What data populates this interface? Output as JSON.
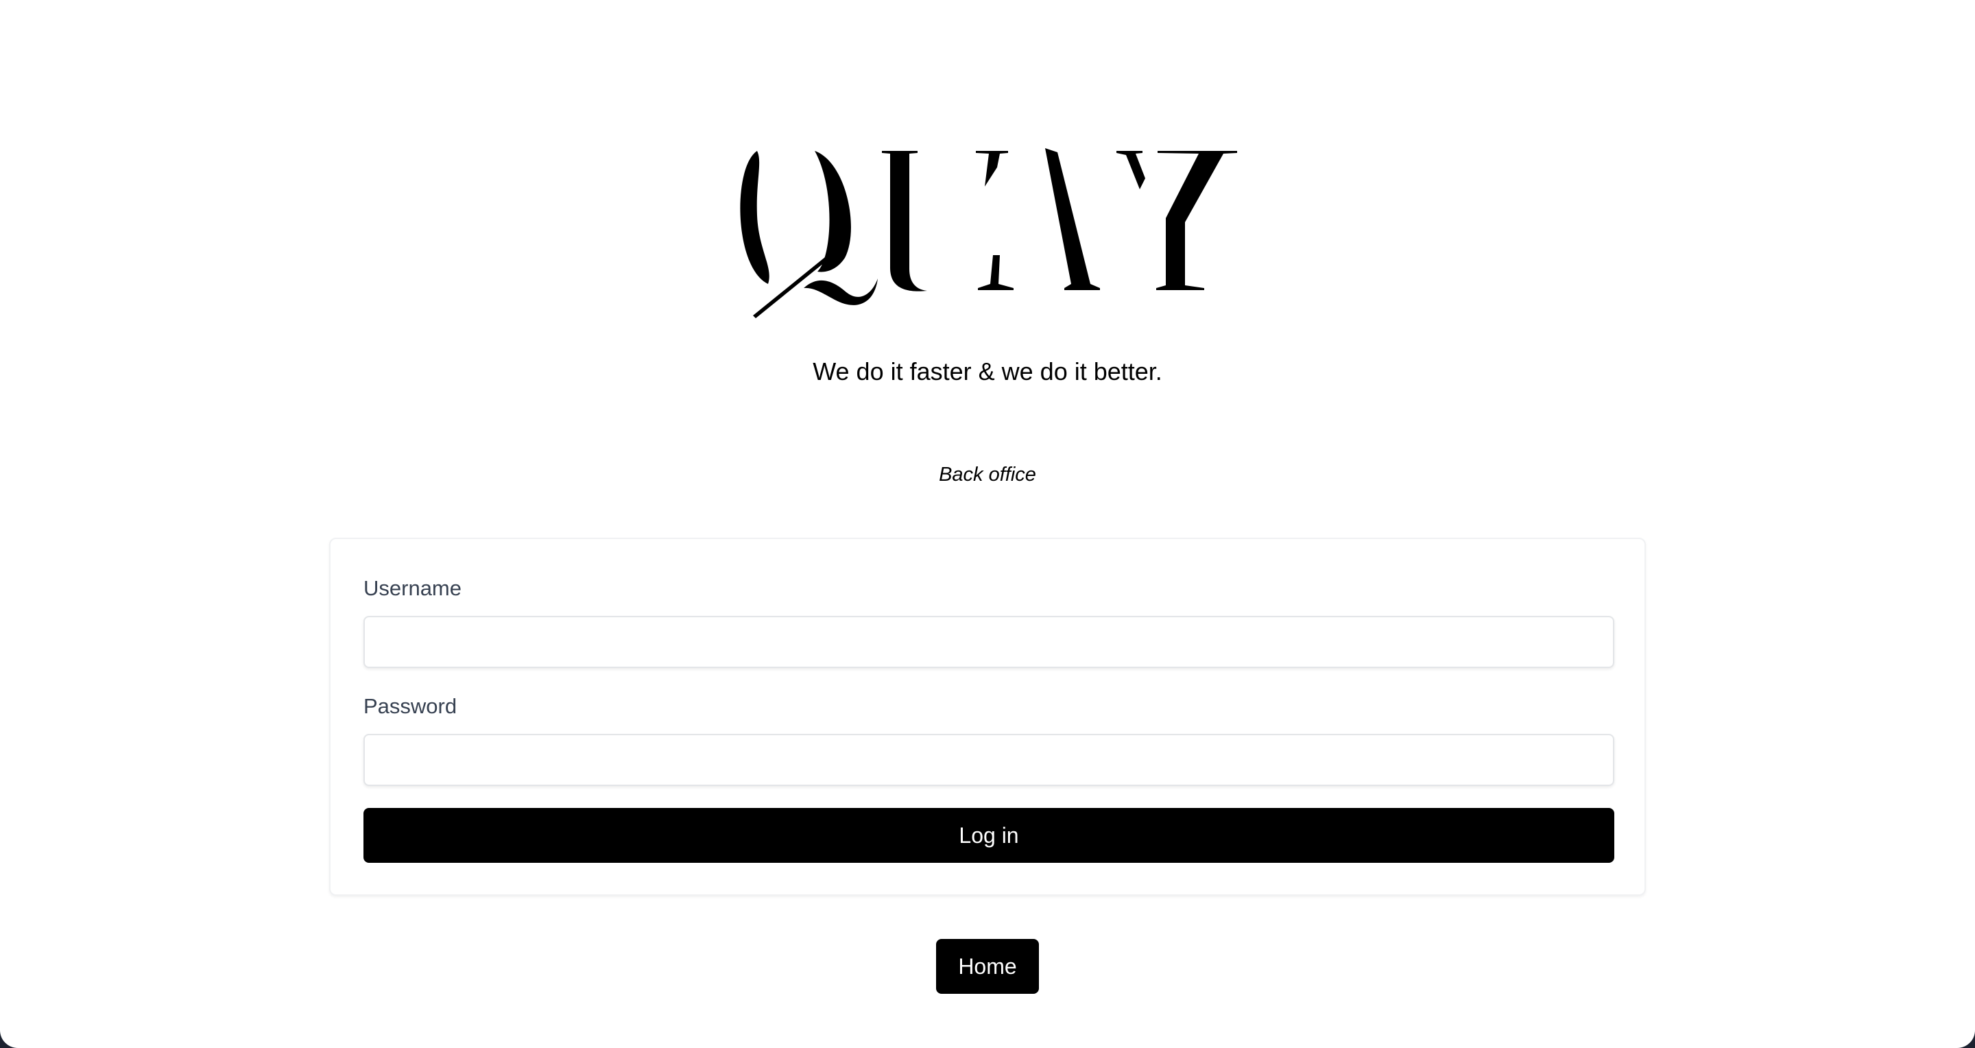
{
  "brand": {
    "logo_text": "QUAY",
    "tagline": "We do it faster & we do it better."
  },
  "section": {
    "label": "Back office"
  },
  "login_form": {
    "username_label": "Username",
    "username_value": "",
    "password_label": "Password",
    "password_value": "",
    "submit_label": "Log in"
  },
  "navigation": {
    "home_label": "Home"
  },
  "colors": {
    "background": "#ffffff",
    "frame": "#1c2230",
    "button": "#000000",
    "button_text": "#ffffff",
    "label_text": "#374151"
  }
}
